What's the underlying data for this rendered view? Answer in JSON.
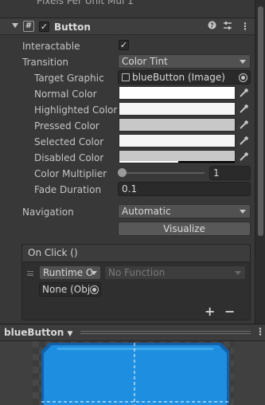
{
  "top_partial": {
    "label": "Pixels Per Unit Mul",
    "value": "1"
  },
  "component": {
    "title": "Button",
    "enabled": true
  },
  "fields": {
    "interactable_label": "Interactable",
    "interactable_checked": true,
    "transition_label": "Transition",
    "transition_value": "Color Tint",
    "target_graphic_label": "Target Graphic",
    "target_graphic_value": "blueButton (Image)",
    "normal_color_label": "Normal Color",
    "highlighted_color_label": "Highlighted Color",
    "pressed_color_label": "Pressed Color",
    "selected_color_label": "Selected Color",
    "disabled_color_label": "Disabled Color",
    "color_multiplier_label": "Color Multiplier",
    "color_multiplier_value": "1",
    "fade_duration_label": "Fade Duration",
    "fade_duration_value": "0.1",
    "navigation_label": "Navigation",
    "navigation_value": "Automatic",
    "visualize_label": "Visualize"
  },
  "colors": {
    "normal": "#ffffff",
    "highlighted": "#f5f5f5",
    "pressed": "#c8c8c8",
    "selected": "#f5f5f5",
    "disabled": "#c8c8c8",
    "button_blue": "#1e8fe0"
  },
  "on_click": {
    "header": "On Click ()",
    "runtime_value": "Runtime O",
    "function_value": "No Function",
    "object_value": "None (Obj",
    "plus": "+",
    "minus": "−"
  },
  "preview": {
    "title": "blueButton"
  }
}
